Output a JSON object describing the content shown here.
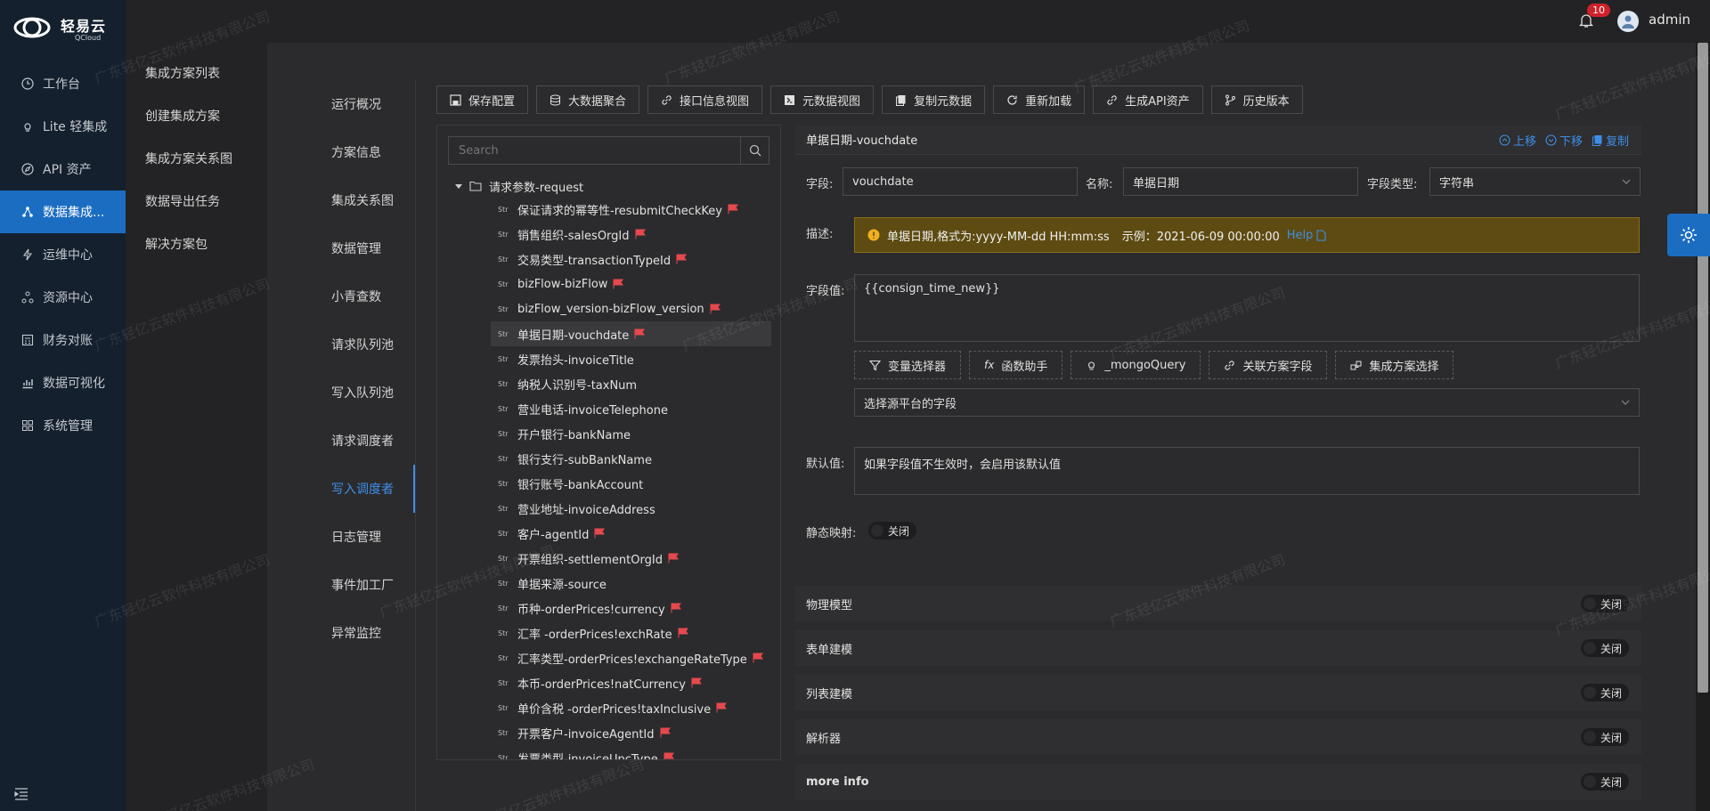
{
  "app": {
    "logo_cn": "轻易云",
    "logo_en": "QCloud",
    "user": "admin",
    "notification_count": "10"
  },
  "sidebar": {
    "items": [
      {
        "label": "工作台",
        "icon": "clock-icon"
      },
      {
        "label": "Lite 轻集成",
        "icon": "bulb-icon"
      },
      {
        "label": "API 资产",
        "icon": "compass-icon"
      },
      {
        "label": "数据集成...",
        "icon": "share-icon",
        "active": true
      },
      {
        "label": "运维中心",
        "icon": "lightning-icon"
      },
      {
        "label": "资源中心",
        "icon": "cluster-icon"
      },
      {
        "label": "财务对账",
        "icon": "calculator-icon"
      },
      {
        "label": "数据可视化",
        "icon": "chart-icon"
      },
      {
        "label": "系统管理",
        "icon": "grid-icon"
      }
    ]
  },
  "subnav": {
    "items": [
      "集成方案列表",
      "创建集成方案",
      "集成方案关系图",
      "数据导出任务",
      "解决方案包"
    ]
  },
  "section_tabs": {
    "items": [
      "运行概况",
      "方案信息",
      "集成关系图",
      "数据管理",
      "小青查数",
      "请求队列池",
      "写入队列池",
      "请求调度者",
      "写入调度者",
      "日志管理",
      "事件加工厂",
      "异常监控"
    ],
    "active_index": 8
  },
  "toolbar": {
    "buttons": [
      {
        "label": "保存配置",
        "icon": "save-icon"
      },
      {
        "label": "大数据聚合",
        "icon": "database-icon"
      },
      {
        "label": "接口信息视图",
        "icon": "link-icon"
      },
      {
        "label": "元数据视图",
        "icon": "code-icon"
      },
      {
        "label": "复制元数据",
        "icon": "copy-icon"
      },
      {
        "label": "重新加载",
        "icon": "reload-icon"
      },
      {
        "label": "生成API资产",
        "icon": "api-icon"
      },
      {
        "label": "历史版本",
        "icon": "branch-icon"
      }
    ]
  },
  "tree": {
    "search_placeholder": "Search",
    "root_label": "请求参数-request",
    "str_tag": "Str",
    "rows": [
      {
        "label": "保证请求的幂等性-resubmitCheckKey",
        "flag": true
      },
      {
        "label": "销售组织-salesOrgId",
        "flag": true
      },
      {
        "label": "交易类型-transactionTypeId",
        "flag": true
      },
      {
        "label": "bizFlow-bizFlow",
        "flag": true
      },
      {
        "label": "bizFlow_version-bizFlow_version",
        "flag": true
      },
      {
        "label": "单据日期-vouchdate",
        "flag": true,
        "selected": true
      },
      {
        "label": "发票抬头-invoiceTitle",
        "flag": false
      },
      {
        "label": "纳税人识别号-taxNum",
        "flag": false
      },
      {
        "label": "营业电话-invoiceTelephone",
        "flag": false
      },
      {
        "label": "开户银行-bankName",
        "flag": false
      },
      {
        "label": "银行支行-subBankName",
        "flag": false
      },
      {
        "label": "银行账号-bankAccount",
        "flag": false
      },
      {
        "label": "营业地址-invoiceAddress",
        "flag": false
      },
      {
        "label": "客户-agentId",
        "flag": true
      },
      {
        "label": "开票组织-settlementOrgId",
        "flag": true
      },
      {
        "label": "单据来源-source",
        "flag": false
      },
      {
        "label": "币种-orderPrices!currency",
        "flag": true
      },
      {
        "label": "汇率 -orderPrices!exchRate",
        "flag": true
      },
      {
        "label": "汇率类型-orderPrices!exchangeRateType",
        "flag": true
      },
      {
        "label": "本币-orderPrices!natCurrency",
        "flag": true
      },
      {
        "label": "单价含税 -orderPrices!taxInclusive",
        "flag": true
      },
      {
        "label": "开票客户-invoiceAgentId",
        "flag": true
      },
      {
        "label": "发票类型-invoiceUpcType",
        "flag": true
      }
    ]
  },
  "detail": {
    "title": "单据日期-vouchdate",
    "actions": [
      "上移",
      "下移",
      "复制"
    ],
    "field_label": "字段:",
    "field_value": "vouchdate",
    "name_label": "名称:",
    "name_value": "单据日期",
    "type_label": "字段类型:",
    "type_value": "字符串",
    "desc_label": "描述:",
    "desc_text": "单据日期,格式为:yyyy-MM-dd HH:mm:ss",
    "desc_example": "示例：2021-06-09 00:00:00",
    "desc_help": "Help",
    "value_label": "字段值:",
    "value_text": "{{consign_time_new}}",
    "tools": [
      {
        "label": "变量选择器",
        "icon": "filter-icon"
      },
      {
        "label": "函数助手",
        "icon": "function-icon",
        "prefix": "fx"
      },
      {
        "label": "_mongoQuery",
        "icon": "bulb-icon"
      },
      {
        "label": "关联方案字段",
        "icon": "link-icon"
      },
      {
        "label": "集成方案选择",
        "icon": "nodes-icon"
      }
    ],
    "source_select_placeholder": "选择源平台的字段",
    "default_label": "默认值:",
    "default_placeholder": "如果字段值不生效时，会启用该默认值",
    "static_label": "静态映射:",
    "static_toggle": "关闭"
  },
  "sections": [
    {
      "label": "物理模型",
      "toggle": "关闭"
    },
    {
      "label": "表单建模",
      "toggle": "关闭"
    },
    {
      "label": "列表建模",
      "toggle": "关闭"
    },
    {
      "label": "解析器",
      "toggle": "关闭"
    },
    {
      "label": "more info",
      "toggle": "关闭"
    }
  ],
  "watermark": "广东轻亿云软件科技有限公司",
  "colors": {
    "accent": "#1b6dc2",
    "link": "#3d8ee8",
    "flag": "#e5484d",
    "warning_bg": "#5e4b12"
  }
}
